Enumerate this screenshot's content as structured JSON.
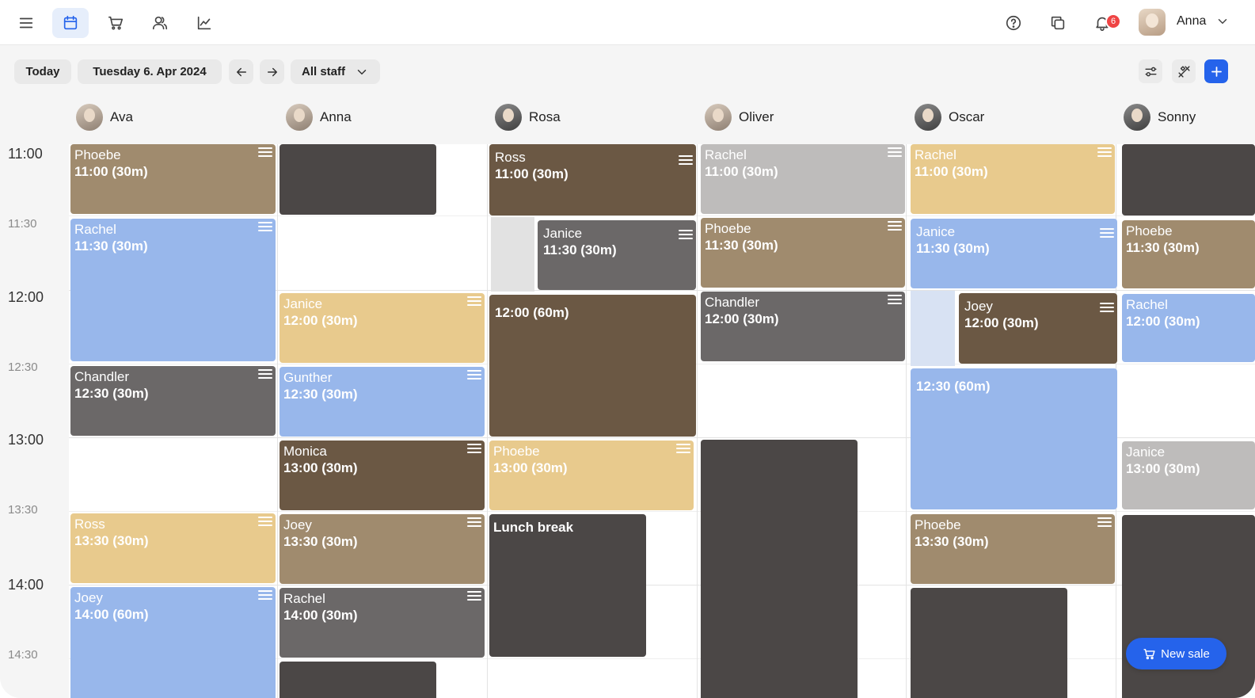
{
  "nav": {
    "notifications_count": "6",
    "user_name": "Anna"
  },
  "toolbar": {
    "today_label": "Today",
    "date_label": "Tuesday 6. Apr 2024",
    "staff_filter_label": "All staff"
  },
  "staff": [
    {
      "name": "Ava"
    },
    {
      "name": "Anna"
    },
    {
      "name": "Rosa"
    },
    {
      "name": "Oliver"
    },
    {
      "name": "Oscar"
    },
    {
      "name": "Sonny"
    }
  ],
  "times": [
    "11:00",
    "11:30",
    "12:00",
    "12:30",
    "13:00",
    "13:30",
    "14:00",
    "14:30"
  ],
  "appointments": {
    "ava": [
      {
        "client": "Phoebe",
        "time": "11:00 (30m)"
      },
      {
        "client": "Rachel",
        "time": "11:30 (30m)"
      },
      {
        "client": "Chandler",
        "time": "12:30 (30m)"
      },
      {
        "client": "Ross",
        "time": "13:30 (30m)"
      },
      {
        "client": "Joey",
        "time": "14:00 (60m)"
      }
    ],
    "anna": [
      {
        "client": "Janice",
        "time": "12:00 (30m)"
      },
      {
        "client": "Gunther",
        "time": "12:30 (30m)"
      },
      {
        "client": "Monica",
        "time": "13:00 (30m)"
      },
      {
        "client": "Joey",
        "time": "13:30 (30m)"
      },
      {
        "client": "Rachel",
        "time": "14:00 (30m)"
      }
    ],
    "rosa": [
      {
        "client": "Ross",
        "time": "11:00 (30m)"
      },
      {
        "client": "Janice",
        "time": "11:30 (30m)"
      },
      {
        "time": "12:00 (60m)"
      },
      {
        "client": "Phoebe",
        "time": "13:00 (30m)"
      },
      {
        "time": "Lunch break"
      }
    ],
    "oliver": [
      {
        "client": "Rachel",
        "time": "11:00 (30m)"
      },
      {
        "client": "Phoebe",
        "time": "11:30 (30m)"
      },
      {
        "client": "Chandler",
        "time": "12:00 (30m)"
      }
    ],
    "oscar": [
      {
        "client": "Rachel",
        "time": "11:00 (30m)"
      },
      {
        "client": "Janice",
        "time": "11:30 (30m)"
      },
      {
        "client": "Joey",
        "time": "12:00 (30m)"
      },
      {
        "time": "12:30 (60m)"
      },
      {
        "client": "Phoebe",
        "time": "13:30 (30m)"
      }
    ],
    "sonny": [
      {
        "client": "Phoebe",
        "time": "11:30 (30m)"
      },
      {
        "client": "Rachel",
        "time": "12:00 (30m)"
      },
      {
        "client": "Janice",
        "time": "13:00 (30m)"
      }
    ]
  },
  "new_sale_label": "New sale",
  "colors": {
    "accent": "#2563eb",
    "tan": "#a08b6e",
    "blue": "#98b7eb",
    "grey": "#6b6868",
    "dark": "#4b4746",
    "brown": "#6b5844",
    "yellow": "#e8ca8d",
    "silver": "#bebcbb",
    "badge": "#ef4444"
  },
  "icons": [
    "menu-icon",
    "calendar-icon",
    "cart-icon",
    "clients-icon",
    "chart-icon",
    "help-icon",
    "copy-icon",
    "bell-icon",
    "chevron-down-icon",
    "arrow-left-icon",
    "arrow-right-icon",
    "sliders-icon",
    "tools-icon",
    "plus-icon"
  ]
}
